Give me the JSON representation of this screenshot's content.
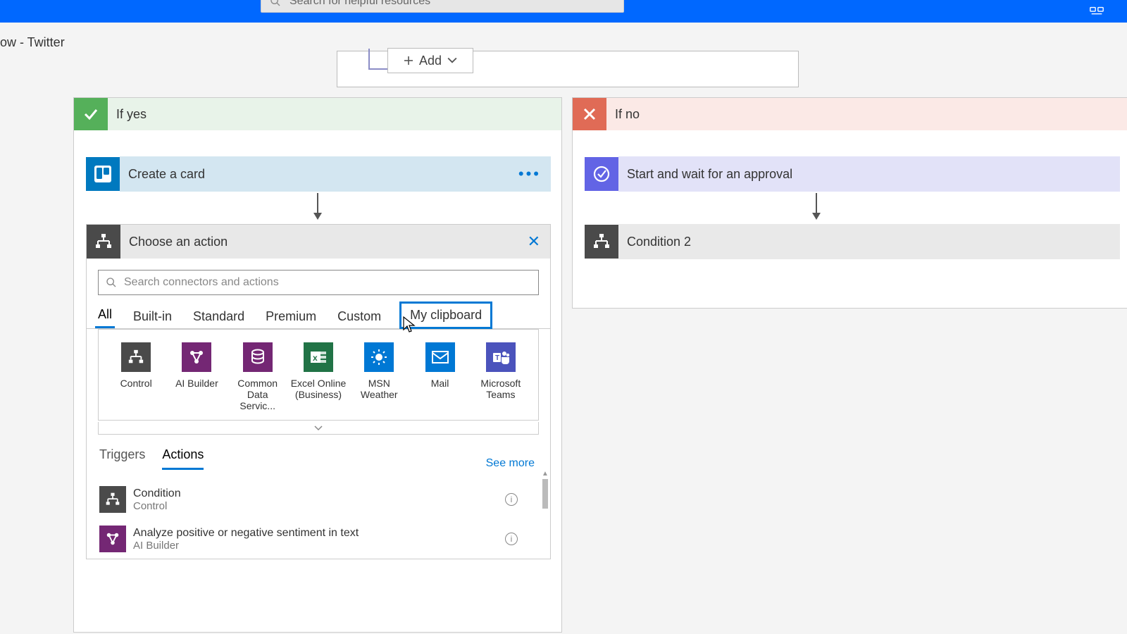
{
  "header": {
    "search_placeholder": "Search for helpful resources"
  },
  "breadcrumb": "ow - Twitter",
  "add_button": "Add",
  "branch_yes": {
    "title": "If yes",
    "card": "Create a card"
  },
  "branch_no": {
    "title": "If no",
    "card1": "Start and wait for an approval",
    "card2": "Condition 2"
  },
  "choose": {
    "title": "Choose an action",
    "search_placeholder": "Search connectors and actions",
    "tabs": [
      "All",
      "Built-in",
      "Standard",
      "Premium",
      "Custom",
      "My clipboard"
    ],
    "connectors": [
      {
        "label": "Control"
      },
      {
        "label": "AI Builder"
      },
      {
        "label": "Common Data Servic..."
      },
      {
        "label": "Excel Online (Business)"
      },
      {
        "label": "MSN Weather"
      },
      {
        "label": "Mail"
      },
      {
        "label": "Microsoft Teams"
      }
    ],
    "ta_tabs": [
      "Triggers",
      "Actions"
    ],
    "see_more": "See more",
    "actions": [
      {
        "title": "Condition",
        "sub": "Control"
      },
      {
        "title": "Analyze positive or negative sentiment in text",
        "sub": "AI Builder"
      }
    ]
  }
}
